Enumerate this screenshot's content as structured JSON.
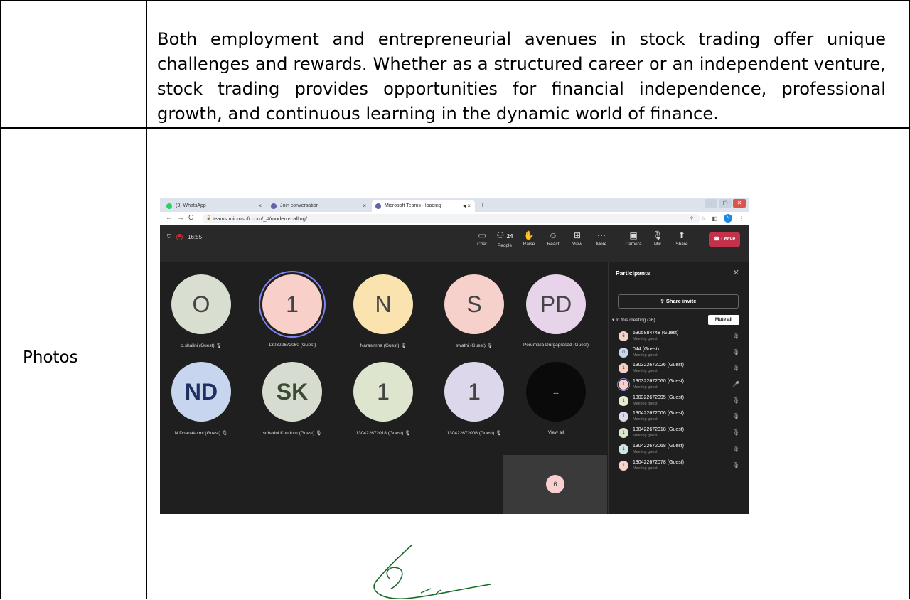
{
  "document": {
    "paragraph": "Both employment and entrepreneurial avenues in stock trading offer unique challenges and rewards. Whether as a structured career or an independent venture, stock trading provides opportunities for financial independence, professional growth, and continuous learning in the dynamic world of finance.",
    "row_label": "Photos"
  },
  "screenshot": {
    "browser": {
      "tabs": [
        {
          "label": "(3) WhatsApp",
          "icon": "whatsapp-icon",
          "color": "#25d366"
        },
        {
          "label": "Join conversation",
          "icon": "teams-icon",
          "color": "#6264a7"
        },
        {
          "label": "Microsoft Teams - loading",
          "icon": "teams-icon",
          "color": "#6264a7"
        }
      ],
      "new_tab": "+",
      "url": "teams.microsoft.com/_#/modern-calling/",
      "profile_initial": "N"
    },
    "teams": {
      "time": "16:55",
      "controls": {
        "chat": "Chat",
        "people": "People",
        "people_count": "24",
        "raise": "Raise",
        "react": "React",
        "view": "View",
        "more": "More",
        "camera": "Camera",
        "mic": "Mic",
        "share": "Share",
        "leave": "Leave"
      },
      "tiles": [
        {
          "initials": "O",
          "name": "o.shalini (Guest)",
          "bg": "#d9dfd0"
        },
        {
          "initials": "1",
          "name": "130322672060 (Guest)",
          "bg": "#f8d0c9"
        },
        {
          "initials": "N",
          "name": "Narasimha (Guest)",
          "bg": "#fbe3b0"
        },
        {
          "initials": "S",
          "name": "swathi (Guest)",
          "bg": "#f6d0ca"
        },
        {
          "initials": "PD",
          "name": "Perumalla Durgaprasad (Guest)",
          "bg": "#e7d3ea"
        },
        {
          "initials": "ND",
          "name": "N Dhanalaxmi (Guest)",
          "bg": "#c7d5ef"
        },
        {
          "initials": "SK",
          "name": "sriharini Kunduru (Guest)",
          "bg": "#d7dcd0"
        },
        {
          "initials": "1",
          "name": "130422672018 (Guest)",
          "bg": "#dde5cf"
        },
        {
          "initials": "1",
          "name": "130422672006 (Guest)",
          "bg": "#ddd7ec"
        },
        {
          "initials": "...",
          "name": "View all",
          "bg": "#0a0a0a"
        }
      ],
      "self_view_initial": "6",
      "panel": {
        "title": "Participants",
        "share_invite": "Share invite",
        "in_meeting": "In this meeting (26)",
        "mute_all": "Mute all",
        "participants": [
          {
            "initial": "6",
            "name": "6305884748 (Guest)",
            "sub": "Meeting guest",
            "bg": "#f6d2cb"
          },
          {
            "initial": "0",
            "name": "044 (Guest)",
            "sub": "Meeting guest",
            "bg": "#c9d6f0"
          },
          {
            "initial": "1",
            "name": "130322672026 (Guest)",
            "sub": "Meeting guest",
            "bg": "#f6cfc4"
          },
          {
            "initial": "1",
            "name": "130322672060 (Guest)",
            "sub": "Meeting guest",
            "bg": "#f8d0c9"
          },
          {
            "initial": "1",
            "name": "130322672095 (Guest)",
            "sub": "Meeting guest",
            "bg": "#e5ecd3"
          },
          {
            "initial": "1",
            "name": "130422672006 (Guest)",
            "sub": "Meeting guest",
            "bg": "#ddd7ec"
          },
          {
            "initial": "1",
            "name": "130422672018 (Guest)",
            "sub": "Meeting guest",
            "bg": "#dde5cf"
          },
          {
            "initial": "1",
            "name": "130422672068 (Guest)",
            "sub": "Meeting guest",
            "bg": "#cde7e0"
          },
          {
            "initial": "1",
            "name": "130422672078 (Guest)",
            "sub": "Meeting guest",
            "bg": "#f6d2cb"
          }
        ]
      }
    }
  }
}
